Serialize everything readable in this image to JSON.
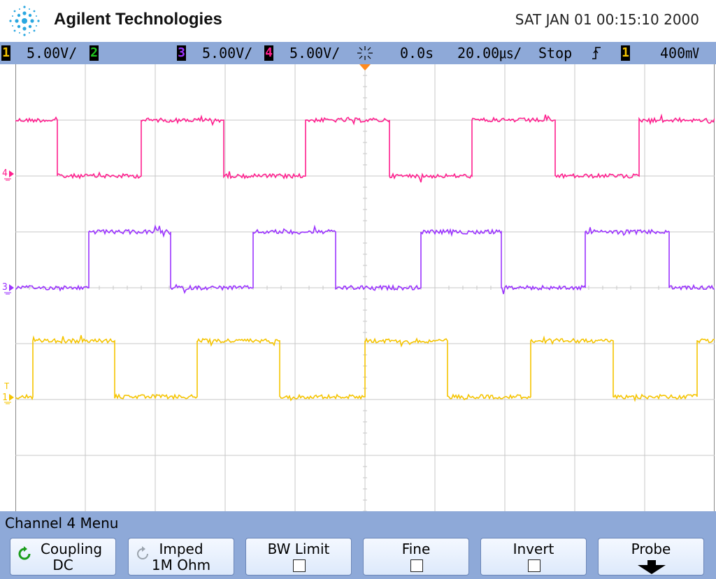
{
  "header": {
    "brand": "Agilent Technologies",
    "datetime": "SAT JAN 01 00:15:10 2000"
  },
  "status_bar": {
    "ch1": {
      "number": "1",
      "scale": "5.00V/",
      "color": "#f5c400"
    },
    "ch2": {
      "number": "2",
      "color": "#1fc61f"
    },
    "ch3": {
      "number": "3",
      "scale": "5.00V/",
      "color": "#9b33ff"
    },
    "ch4": {
      "number": "4",
      "scale": "5.00V/",
      "color": "#ff1f8e"
    },
    "time_offset": "0.0s",
    "time_scale": "20.00㎲/",
    "run_state": "Stop",
    "trigger_source": "1",
    "trigger_level": "400㎷"
  },
  "traces": [
    {
      "channel": "4",
      "color": "#ff1f8e",
      "high_div": 1.0,
      "low_div": 2.0,
      "edges_div": [
        0.6,
        1.8,
        2.98,
        4.15,
        5.35,
        6.53,
        7.72,
        8.92
      ],
      "start": "high"
    },
    {
      "channel": "3",
      "color": "#9b33ff",
      "high_div": 3.0,
      "low_div": 4.0,
      "edges_div": [
        1.05,
        2.22,
        3.4,
        4.58,
        5.8,
        6.95,
        8.15,
        9.35
      ],
      "start": "low"
    },
    {
      "channel": "1",
      "color": "#f5c400",
      "high_div": 4.95,
      "low_div": 5.95,
      "edges_div": [
        0.25,
        1.42,
        2.6,
        3.78,
        5.0,
        6.18,
        7.37,
        8.55,
        9.75
      ],
      "start": "low"
    }
  ],
  "markers": {
    "ch4": "4",
    "ch3": "3",
    "ch1": "1",
    "trigger_level": "T"
  },
  "menu": {
    "title": "Channel 4  Menu",
    "softkeys": [
      {
        "label": "Coupling",
        "value": "DC",
        "icon": "cycle-icon"
      },
      {
        "label": "Imped",
        "value": "1M Ohm",
        "icon": "cycle-icon"
      },
      {
        "label": "BW Limit",
        "state": "off",
        "icon": "checkbox"
      },
      {
        "label": "Fine",
        "state": "off",
        "icon": "checkbox"
      },
      {
        "label": "Invert",
        "state": "off",
        "icon": "checkbox"
      },
      {
        "label": "Probe",
        "icon": "down-arrow-icon"
      }
    ]
  }
}
